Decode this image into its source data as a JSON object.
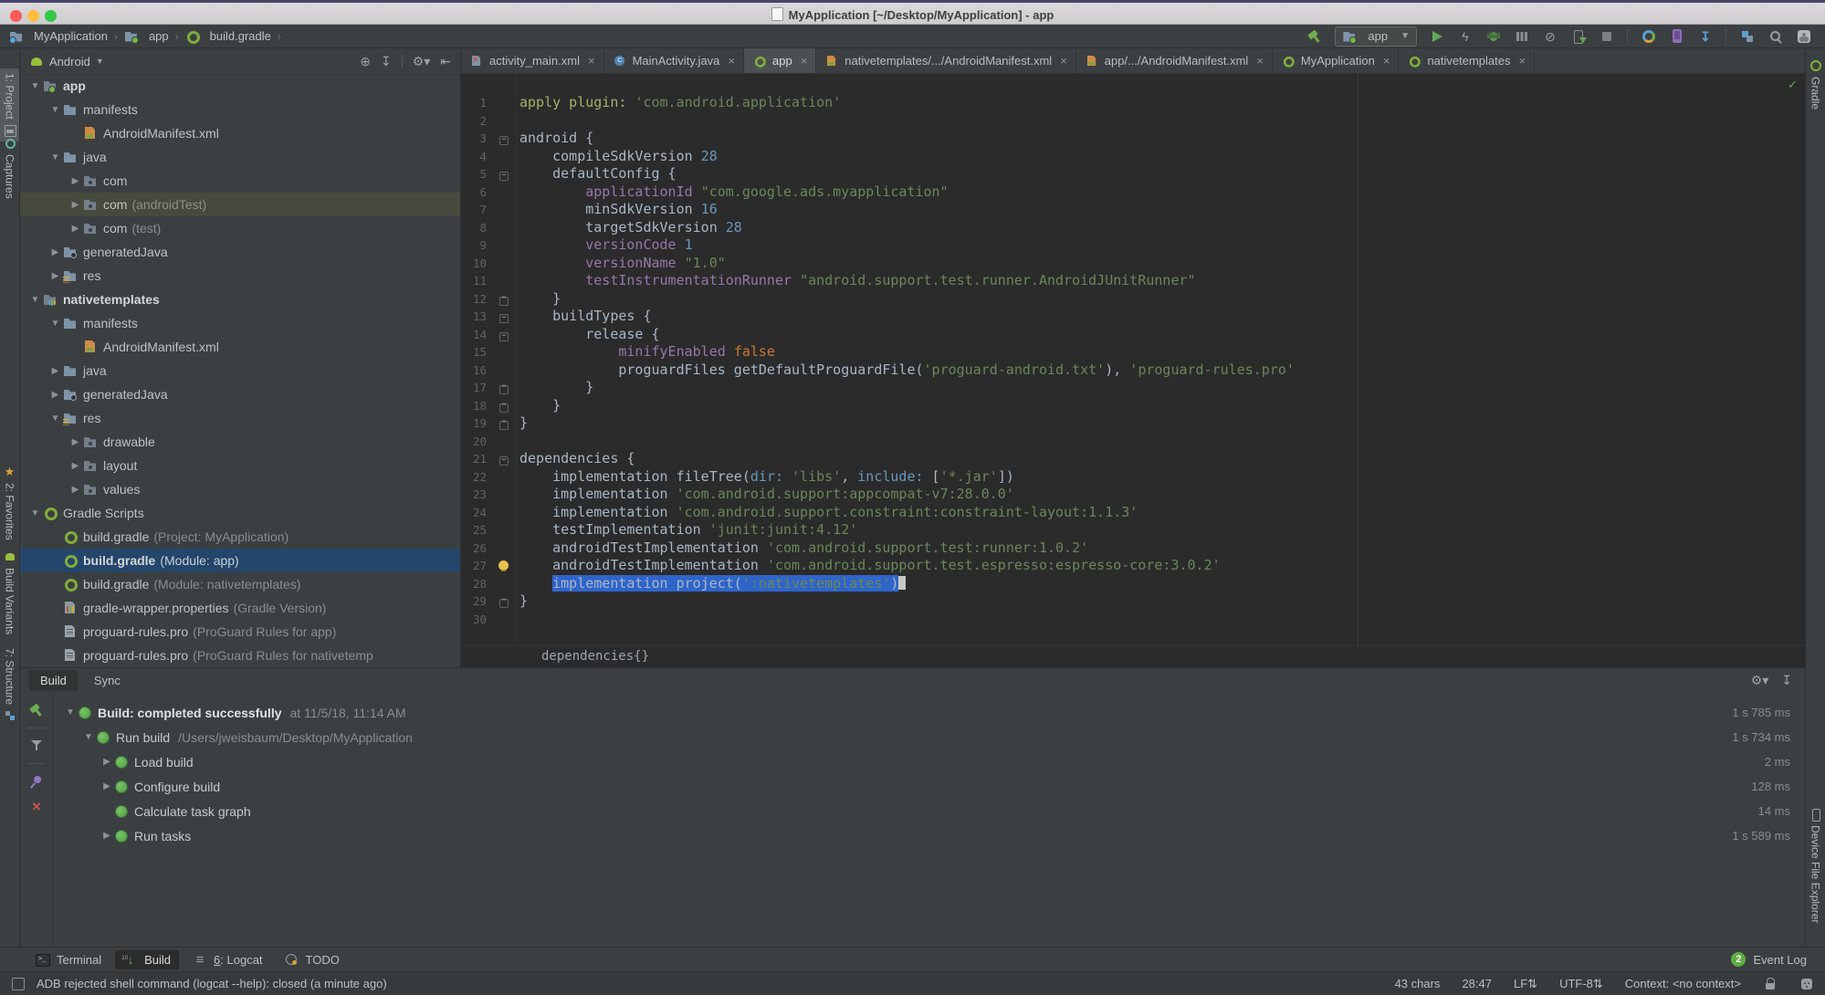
{
  "titlebar": {
    "title": "MyApplication [~/Desktop/MyApplication] - app"
  },
  "navbar": {
    "breadcrumbs": [
      {
        "icon": "project-folder",
        "label": "MyApplication"
      },
      {
        "icon": "module-folder",
        "label": "app"
      },
      {
        "icon": "gradle",
        "label": "build.gradle"
      }
    ],
    "run_config": "app",
    "toolbar": [
      {
        "t": "icon",
        "name": "build-hammer"
      },
      {
        "t": "runconfig"
      },
      {
        "t": "icon",
        "name": "run"
      },
      {
        "t": "icon",
        "name": "apply-changes"
      },
      {
        "t": "icon",
        "name": "debug"
      },
      {
        "t": "icon",
        "name": "profiler"
      },
      {
        "t": "icon",
        "name": "attach-debugger"
      },
      {
        "t": "icon",
        "name": "device-run"
      },
      {
        "t": "icon",
        "name": "stop"
      },
      {
        "t": "sep"
      },
      {
        "t": "icon",
        "name": "sync-gradle"
      },
      {
        "t": "icon",
        "name": "avd-manager"
      },
      {
        "t": "icon",
        "name": "sdk-manager"
      },
      {
        "t": "sep"
      },
      {
        "t": "icon",
        "name": "project-structure"
      },
      {
        "t": "icon",
        "name": "search-everywhere"
      },
      {
        "t": "icon",
        "name": "avatar"
      }
    ]
  },
  "left_strip": {
    "items": [
      {
        "label": "1: Project",
        "icon": "project",
        "active": true,
        "icon_after": true
      },
      {
        "label": "Captures",
        "icon": "captures"
      },
      {
        "label": "2: Favorites",
        "icon": "favorites"
      },
      {
        "label": "Build Variants",
        "icon": "build-variants"
      },
      {
        "label": "7: Structure",
        "icon": "structure",
        "icon_after": true
      }
    ]
  },
  "right_strip": {
    "items": [
      {
        "label": "Gradle",
        "icon": "gradle"
      },
      {
        "label": "Device File Explorer",
        "icon": "device"
      }
    ]
  },
  "project_panel": {
    "mode": "Android",
    "header_icons": [
      "locate",
      "collapse-all",
      "|",
      "settings",
      "hide-panel"
    ],
    "tree": [
      {
        "i": 0,
        "a": "v",
        "icon": "f-package f-app",
        "label": "app",
        "bold": true
      },
      {
        "i": 1,
        "a": "v",
        "icon": "",
        "label": "manifests"
      },
      {
        "i": 2,
        "a": "",
        "icon": "f-manifest",
        "label": "AndroidManifest.xml"
      },
      {
        "i": 1,
        "a": "v",
        "icon": "",
        "label": "java"
      },
      {
        "i": 2,
        "a": ">",
        "icon": "f-package",
        "label": "com"
      },
      {
        "i": 2,
        "a": ">",
        "icon": "f-package",
        "label": "com",
        "suffix": "(androidTest)",
        "hl": true
      },
      {
        "i": 2,
        "a": ">",
        "icon": "f-package",
        "label": "com",
        "suffix": "(test)"
      },
      {
        "i": 1,
        "a": ">",
        "icon": "f-gen",
        "label": "generatedJava"
      },
      {
        "i": 1,
        "a": ">",
        "icon": "f-res",
        "label": "res"
      },
      {
        "i": 0,
        "a": "v",
        "icon": "f-package f-native",
        "label": "nativetemplates",
        "bold": true
      },
      {
        "i": 1,
        "a": "v",
        "icon": "",
        "label": "manifests"
      },
      {
        "i": 2,
        "a": "",
        "icon": "f-manifest",
        "label": "AndroidManifest.xml"
      },
      {
        "i": 1,
        "a": ">",
        "icon": "",
        "label": "java"
      },
      {
        "i": 1,
        "a": ">",
        "icon": "f-gen",
        "label": "generatedJava"
      },
      {
        "i": 1,
        "a": "v",
        "icon": "f-res",
        "label": "res"
      },
      {
        "i": 2,
        "a": ">",
        "icon": "f-package",
        "label": "drawable"
      },
      {
        "i": 2,
        "a": ">",
        "icon": "f-package",
        "label": "layout"
      },
      {
        "i": 2,
        "a": ">",
        "icon": "f-package",
        "label": "values"
      },
      {
        "i": 0,
        "a": "v",
        "icon": "f-gradle",
        "label": "Gradle Scripts"
      },
      {
        "i": 1,
        "a": "",
        "icon": "f-gradle",
        "label": "build.gradle",
        "suffix": "(Project: MyApplication)"
      },
      {
        "i": 1,
        "a": "",
        "icon": "f-gradle",
        "label": "build.gradle",
        "suffix": "(Module: app)",
        "sel": true
      },
      {
        "i": 1,
        "a": "",
        "icon": "f-gradle",
        "label": "build.gradle",
        "suffix": "(Module: nativetemplates)"
      },
      {
        "i": 1,
        "a": "",
        "icon": "f-wrapper",
        "label": "gradle-wrapper.properties",
        "suffix": "(Gradle Version)"
      },
      {
        "i": 1,
        "a": "",
        "icon": "f-text",
        "label": "proguard-rules.pro",
        "suffix": "(ProGuard Rules for app)"
      },
      {
        "i": 1,
        "a": "",
        "icon": "f-text",
        "label": "proguard-rules.pro",
        "suffix": "(ProGuard Rules for nativetemp"
      }
    ]
  },
  "editor": {
    "tabs": [
      {
        "icon": "f-layout-file",
        "label": "activity_main.xml"
      },
      {
        "icon": "f-class-file",
        "label": "MainActivity.java"
      },
      {
        "icon": "f-gradle",
        "label": "app",
        "sel": true
      },
      {
        "icon": "f-manifest",
        "label": "nativetemplates/.../AndroidManifest.xml"
      },
      {
        "icon": "f-manifest",
        "label": "app/.../AndroidManifest.xml"
      },
      {
        "icon": "f-gradle",
        "label": "MyApplication"
      },
      {
        "icon": "f-gradle",
        "label": "nativetemplates"
      }
    ],
    "hint": "dependencies{}",
    "lines": [
      {
        "n": 1,
        "segs": [
          [
            "o",
            "apply plugin: "
          ],
          [
            "s",
            "'com.android.application'"
          ]
        ]
      },
      {
        "n": 2,
        "segs": []
      },
      {
        "n": 3,
        "f": "o",
        "segs": [
          [
            "d",
            "android {"
          ]
        ]
      },
      {
        "n": 4,
        "segs": [
          [
            "d",
            "    compileSdkVersion "
          ],
          [
            "n",
            "28"
          ]
        ]
      },
      {
        "n": 5,
        "f": "o",
        "segs": [
          [
            "d",
            "    defaultConfig {"
          ]
        ]
      },
      {
        "n": 6,
        "segs": [
          [
            "d",
            "        "
          ],
          [
            "p",
            "applicationId"
          ],
          [
            "d",
            " "
          ],
          [
            "s",
            "\"com.google.ads.myapplication\""
          ]
        ]
      },
      {
        "n": 7,
        "segs": [
          [
            "d",
            "        minSdkVersion "
          ],
          [
            "n",
            "16"
          ]
        ]
      },
      {
        "n": 8,
        "segs": [
          [
            "d",
            "        targetSdkVersion "
          ],
          [
            "n",
            "28"
          ]
        ]
      },
      {
        "n": 9,
        "segs": [
          [
            "d",
            "        "
          ],
          [
            "p",
            "versionCode"
          ],
          [
            "d",
            " "
          ],
          [
            "n",
            "1"
          ]
        ]
      },
      {
        "n": 10,
        "segs": [
          [
            "d",
            "        "
          ],
          [
            "p",
            "versionName"
          ],
          [
            "d",
            " "
          ],
          [
            "s",
            "\"1.0\""
          ]
        ]
      },
      {
        "n": 11,
        "segs": [
          [
            "d",
            "        "
          ],
          [
            "p",
            "testInstrumentationRunner"
          ],
          [
            "d",
            " "
          ],
          [
            "s",
            "\"android.support.test.runner.AndroidJUnitRunner\""
          ]
        ]
      },
      {
        "n": 12,
        "f": "c",
        "segs": [
          [
            "d",
            "    }"
          ]
        ]
      },
      {
        "n": 13,
        "f": "o",
        "segs": [
          [
            "d",
            "    buildTypes {"
          ]
        ]
      },
      {
        "n": 14,
        "f": "o",
        "segs": [
          [
            "d",
            "        release {"
          ]
        ]
      },
      {
        "n": 15,
        "segs": [
          [
            "d",
            "            "
          ],
          [
            "p",
            "minifyEnabled"
          ],
          [
            "d",
            " "
          ],
          [
            "k",
            "false"
          ]
        ]
      },
      {
        "n": 16,
        "segs": [
          [
            "d",
            "            proguardFiles getDefaultProguardFile("
          ],
          [
            "s",
            "'proguard-android.txt'"
          ],
          [
            "d",
            "), "
          ],
          [
            "s",
            "'proguard-rules.pro'"
          ]
        ]
      },
      {
        "n": 17,
        "f": "c",
        "segs": [
          [
            "d",
            "        }"
          ]
        ]
      },
      {
        "n": 18,
        "f": "c",
        "segs": [
          [
            "d",
            "    }"
          ]
        ]
      },
      {
        "n": 19,
        "f": "c",
        "segs": [
          [
            "d",
            "}"
          ]
        ]
      },
      {
        "n": 20,
        "segs": []
      },
      {
        "n": 21,
        "f": "o",
        "segs": [
          [
            "d",
            "dependencies {"
          ]
        ]
      },
      {
        "n": 22,
        "segs": [
          [
            "d",
            "    implementation fileTree("
          ],
          [
            "b",
            "dir:"
          ],
          [
            "d",
            " "
          ],
          [
            "s",
            "'libs'"
          ],
          [
            "d",
            ", "
          ],
          [
            "b",
            "include:"
          ],
          [
            "d",
            " ["
          ],
          [
            "s",
            "'*.jar'"
          ],
          [
            "d",
            "])"
          ]
        ]
      },
      {
        "n": 23,
        "segs": [
          [
            "d",
            "    implementation "
          ],
          [
            "s",
            "'com.android.support:appcompat-v7:28.0.0'"
          ]
        ]
      },
      {
        "n": 24,
        "segs": [
          [
            "d",
            "    implementation "
          ],
          [
            "s",
            "'com.android.support.constraint:constraint-layout:1.1.3'"
          ]
        ]
      },
      {
        "n": 25,
        "segs": [
          [
            "d",
            "    testImplementation "
          ],
          [
            "s",
            "'junit:junit:4.12'"
          ]
        ]
      },
      {
        "n": 26,
        "segs": [
          [
            "d",
            "    androidTestImplementation "
          ],
          [
            "s",
            "'com.android.support.test:runner:1.0.2'"
          ]
        ]
      },
      {
        "n": 27,
        "bulb": true,
        "segs": [
          [
            "d",
            "    androidTestImplementation "
          ],
          [
            "s",
            "'com.android.support.test.espresso:espresso-core:3.0.2'"
          ]
        ]
      },
      {
        "n": 28,
        "caret": true,
        "segs": [
          [
            "d",
            "    "
          ],
          [
            "d",
            "implementation project(",
            true
          ],
          [
            "s",
            "':nativetemplates'",
            true
          ],
          [
            "d",
            ")",
            true
          ]
        ]
      },
      {
        "n": 29,
        "f": "c",
        "segs": [
          [
            "d",
            "}"
          ]
        ]
      },
      {
        "n": 30,
        "segs": []
      }
    ]
  },
  "build_panel": {
    "tabs": [
      {
        "label": "Build",
        "sel": true
      },
      {
        "label": "Sync"
      }
    ],
    "header_icons": [
      "settings",
      "scroll-down"
    ],
    "tool_icons": [
      "build-hammer",
      "|",
      "filter",
      "|",
      "pin",
      "close-x"
    ],
    "rows": [
      {
        "i": 0,
        "a": "v",
        "bold": true,
        "label": "Build: completed successfully",
        "detail": "at 11/5/18, 11:14 AM",
        "time": "1 s 785 ms"
      },
      {
        "i": 1,
        "a": "v",
        "label": "Run build",
        "detail": "/Users/jweisbaum/Desktop/MyApplication",
        "time": "1 s 734 ms"
      },
      {
        "i": 2,
        "a": ">",
        "label": "Load build",
        "time": "2 ms"
      },
      {
        "i": 2,
        "a": ">",
        "label": "Configure build",
        "time": "128 ms"
      },
      {
        "i": 2,
        "a": "",
        "label": "Calculate task graph",
        "time": "14 ms"
      },
      {
        "i": 2,
        "a": ">",
        "label": "Run tasks",
        "time": "1 s 589 ms"
      }
    ]
  },
  "bottom_bar": {
    "items": [
      {
        "label": "Terminal",
        "icon": "terminal"
      },
      {
        "label": "Build",
        "icon": "build-arrow",
        "sel": true
      },
      {
        "label": "6: Logcat",
        "icon": "logcat",
        "u": true
      },
      {
        "label": "TODO",
        "icon": "todo"
      }
    ],
    "event_log": {
      "badge": "2",
      "label": "Event Log"
    }
  },
  "status_bar": {
    "message": "ADB rejected shell command (logcat --help): closed (a minute ago)",
    "items": [
      "43 chars",
      "28:47",
      "LF⇅",
      "UTF-8⇅",
      "Context: <no context>"
    ]
  }
}
